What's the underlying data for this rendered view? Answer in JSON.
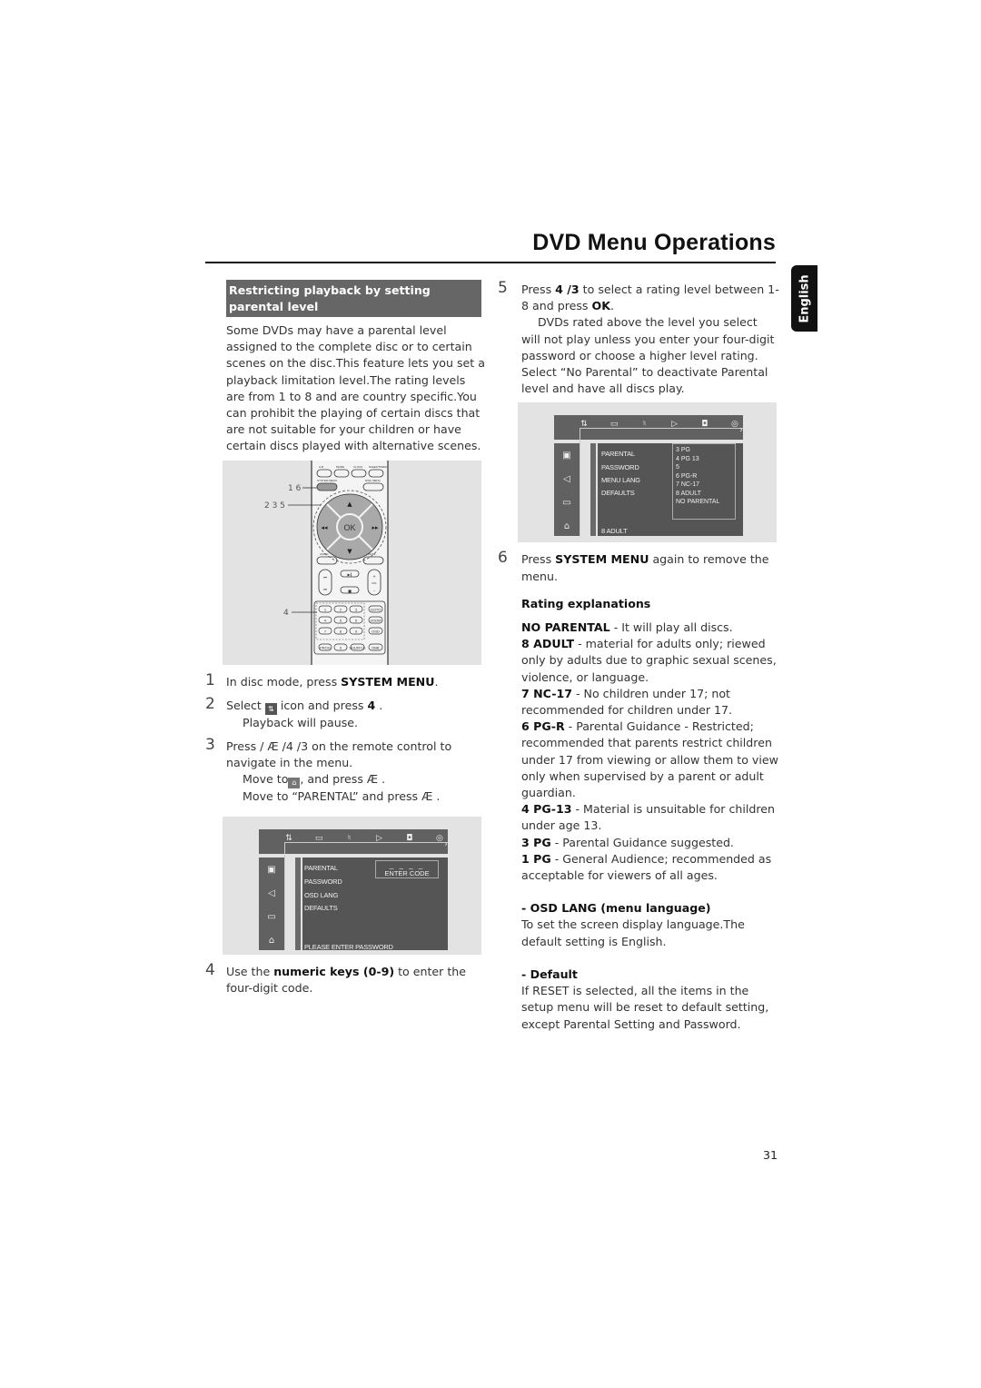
{
  "header": {
    "title": "DVD Menu Operations",
    "language_tab": "English"
  },
  "left_column": {
    "section_title": "Restricting playback by setting parental level",
    "intro": "Some DVDs may have a parental level assigned to the complete disc or to certain scenes on the disc.This feature lets you set a playback limitation level.The rating levels are from 1 to 8 and are country specific.You can prohibit the playing of certain discs that are not suitable for your children or have certain discs played with alternative scenes.",
    "remote_figure": {
      "callouts": [
        "1 6",
        "2 3 5",
        "4"
      ],
      "top_buttons": [
        "A-B",
        "MODE",
        "CLOCK",
        "SLEEP/TIMER"
      ],
      "system_menu_label": "SYSTEM MENU",
      "disc_menu_label": "DISC MENU",
      "ok_label": "OK",
      "audio_label": "AUDIO",
      "mute_label": "MUTE",
      "vol_label": "VOL",
      "numeric_keys": [
        "1",
        "2",
        "3",
        "4",
        "5",
        "6",
        "7",
        "8",
        "9",
        "0"
      ],
      "side_keys": [
        "GOTO",
        "ZOOM",
        "OSD",
        "PROG",
        "SHUFFLE",
        "DBB"
      ]
    },
    "steps": [
      {
        "num": "1",
        "text_before": "In disc mode, press ",
        "bold": "SYSTEM MENU",
        "text_after": "."
      },
      {
        "num": "2",
        "text_before": "Select ",
        "icon": "parental-settings-icon",
        "text_mid": " icon and press ",
        "bold": "4",
        "text_after": " .",
        "sub": "Playback will pause."
      },
      {
        "num": "3",
        "line1": "Press      / Æ /4 /3   on the remote control to navigate in the menu.",
        "sub1_before": "Move to",
        "sub1_after": ", and press Æ .",
        "sub2": "Move to “PARENTAL” and press Æ ."
      },
      {
        "num": "4",
        "text_before": "Use the ",
        "bold": "numeric keys (0-9)",
        "text_after": " to enter the four-digit code."
      }
    ],
    "menu_screen": {
      "items": [
        "PARENTAL",
        "PASSWORD",
        "OSD LANG",
        "DEFAULTS"
      ],
      "code_placeholder": "_ _ _ _",
      "code_label": "ENTER CODE",
      "status": "PLEASE ENTER PASSWORD"
    }
  },
  "right_column": {
    "step5": {
      "num": "5",
      "text_before": "Press ",
      "bold_keys": "4 /3",
      "text_mid": "  to select a rating level between 1-8 and press ",
      "bold_ok": "OK",
      "text_after": ".",
      "note": "DVDs rated above the level you select will not play unless you enter your four-digit password or choose a higher level rating. Select “No Parental” to deactivate Parental level and have all discs play."
    },
    "menu_screen": {
      "items": [
        "PARENTAL",
        "PASSWORD",
        "MENU LANG",
        "DEFAULTS"
      ],
      "rating_options": [
        "3 PG",
        "4 PG 13",
        "5",
        "6 PG-R",
        "7 NC-17",
        "8 ADULT",
        "NO PARENTAL"
      ],
      "status": "8 ADULT"
    },
    "step6": {
      "num": "6",
      "text_before": "Press ",
      "bold": "SYSTEM MENU",
      "text_after": " again to remove the menu."
    },
    "rating_heading": "Rating explanations",
    "ratings": [
      {
        "code": "NO PARENTAL",
        "desc": "  - It will play all discs."
      },
      {
        "code": "8 ADULT",
        "desc": " - material for adults only; riewed only by adults due to graphic sexual scenes, violence, or language."
      },
      {
        "code": "7 NC-17",
        "desc": " - No children under 17; not recommended for children under 17."
      },
      {
        "code": "6 PG-R",
        "desc": " - Parental Guidance - Restricted; recommended that parents restrict children under 17 from viewing or allow them to view only when supervised by a parent or adult guardian."
      },
      {
        "code": "4 PG-13",
        "desc": " - Material  is unsuitable for children under age 13."
      },
      {
        "code": "3 PG",
        "desc": " - Parental Guidance suggested."
      },
      {
        "code": "1 PG",
        "desc": " - General Audience; recommended as acceptable for viewers of all ages."
      }
    ],
    "osd_lang": {
      "heading": "- OSD LANG (menu language)",
      "text": "To set the screen display language.The default setting is English."
    },
    "default": {
      "heading": "- Default",
      "text": "If RESET is selected, all the items in the setup menu will be reset to default setting,  except Parental Setting and Password."
    }
  },
  "footer": {
    "page_number": "31"
  }
}
